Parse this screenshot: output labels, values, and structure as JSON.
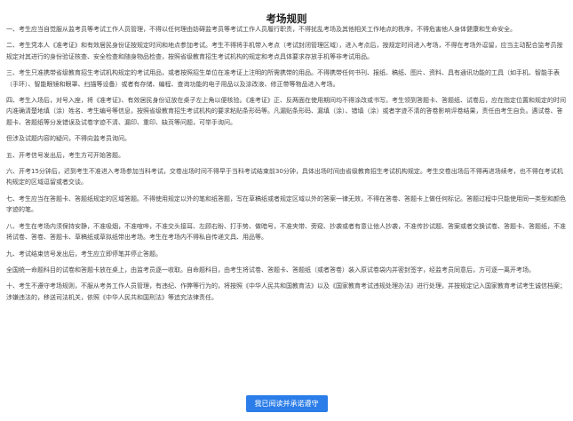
{
  "page": {
    "title": "考场规则",
    "agree_button": "我已阅读并承诺遵守",
    "accent_color": "#2b7de9"
  },
  "rules": [
    "一、考生应当自觉服从监考员等考试工作人员管理，不得以任何理由妨碍监考员等考试工作人员履行职责，不得扰乱考场及其他相关工作地点的秩序，不得危害他人身体健康和生命安全。",
    "二、考生凭本人《准考证》和有效居民身份证按规定时间和地点参加考试。考生不得将手机带入考点（考试封闭管理区域），进入考点后，按规定时间进入考场，不得在考场外逗留，应当主动配合监考员按规定对其进行的身份验证核查、安全检查和随身物品检查，按照省级教育招生考试机构的规定和考点具体要求存放手机等非考试用品。",
    "三、考生只准携带省级教育招生考试机构规定的考试用品，或者按照招生单位在准考证上注明的所需携带的用品。不得携带任何书刊、报纸、稿纸、图片、资料、具有通讯功能的工具（如手机、智能手表（手环）、智能眼镜和眼罩、扫描等设备）或者有存储、编程、查询功能的电子用品以及涂改液、修正带等物品进入考场。",
    "四、考生入场后，对号入座，将《准考证》、有效居民身份证放在桌子左上角以便核验。《准考证》正、反两面在使用期间均不得涂改或书写。考生领到答题卡、答题纸、试卷后，应在指定位置和规定的时间内准确清楚地填（涂）姓名、考生编号等信息，按照省级教育招生考试机构的要求粘贴条形码等。凡漏贴条形码、漏填（涂）、错填（涂）或者字迹不清的答卷影响评卷结果，责任由考生自负。遇试卷、答题卡、答题纸等分发错误及试卷字迹不清、漏印、重印、缺页等问题，可举手询问。",
    "但涉及试题内容的疑问，不得向监考员询问。",
    "五、开考信号发出后，考生方可开始答题。",
    "六、开考15分钟后，迟到考生不准进入考场参加当科考试，交卷出场时间不得早于当科考试结束前30分钟，具体出场时间由省级教育招生考试机构规定。考生交卷出场后不得再进场续考，也不得在考试机构规定的区域逗留或者交谈。",
    "七、考生应当在答题卡、答题纸规定的区域答题。不得使用规定以外的笔和纸答题，写在草稿纸或者规定区域以外的答案一律无效，不得在答卷、答题卡上做任何标记。答题过程中只能使用同一类型和颜色字迹的笔。",
    "八、考生在考场内须保持安静，不准吸烟，不准喧哗，不准交头接耳、左顾右盼、打手势、做暗号，不准夹带、旁窥、抄袭或者有意让他人抄袭，不准传抄试题、答案或者交换试卷、答题卡、答题纸，不准将试卷、答卷、答题卡、草稿纸或草拟纸带出考场。考生在考场内不得私自传递文具、用品等。",
    "九、考试结束信号发出后，考生应立即停笔并停止答题。",
    "全国统一命题科目的试卷和答题卡放在桌上，由监考员逐一收取。自命题科目，由考生将试卷、答题卡、答题纸（或者答卷）装入原试卷袋内并密封签字，经监考员同意后，方可逐一离开考场。",
    "十、考生不遵守考场规则，不服从考务工作人员管理，有违纪、作弊等行为的，将按照《中华人民共和国教育法》以及《国家教育考试违规处理办法》进行处理，并按规定记入国家教育考试考生诚信档案；涉嫌违法的，移送司法机关，依照《中华人民共和国刑法》等追究法律责任。"
  ]
}
